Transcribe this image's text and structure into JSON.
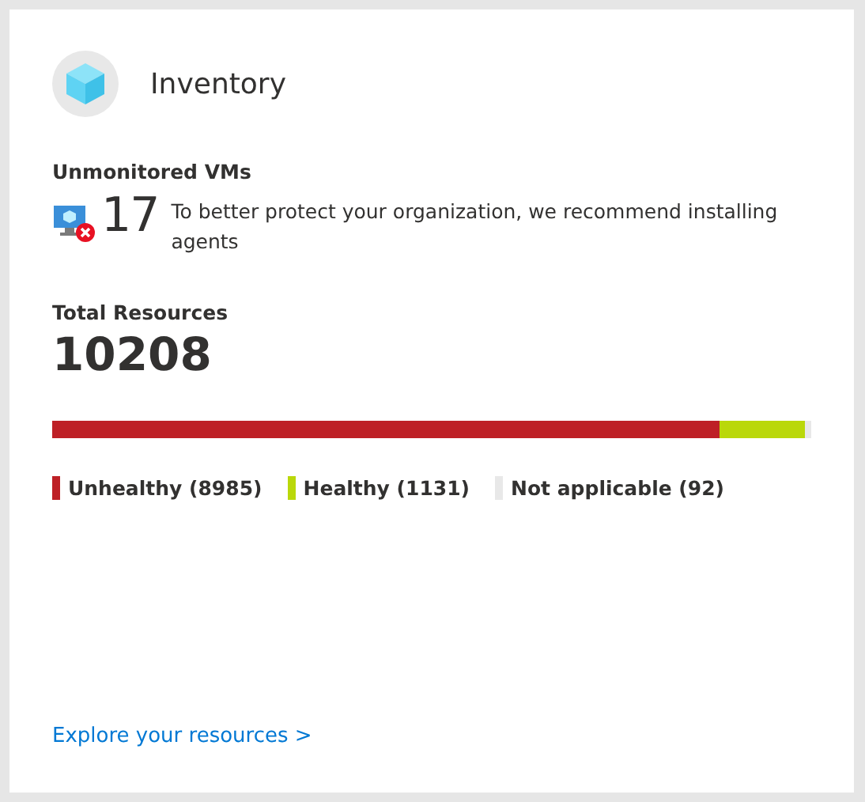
{
  "card": {
    "title": "Inventory"
  },
  "unmonitored": {
    "label": "Unmonitored VMs",
    "count": "17",
    "message": "To better protect your organization, we recommend installing agents"
  },
  "total": {
    "label": "Total Resources",
    "value": "10208"
  },
  "segments": [
    {
      "label": "Unhealthy (8985)",
      "color": "#be2026",
      "level": 0.88
    },
    {
      "label": "Healthy (1131)",
      "color": "#bad80a",
      "level": 0.991
    },
    {
      "label": "Not applicable (92)",
      "color": "#e8e8e8"
    }
  ],
  "link": "Explore your resources >"
}
